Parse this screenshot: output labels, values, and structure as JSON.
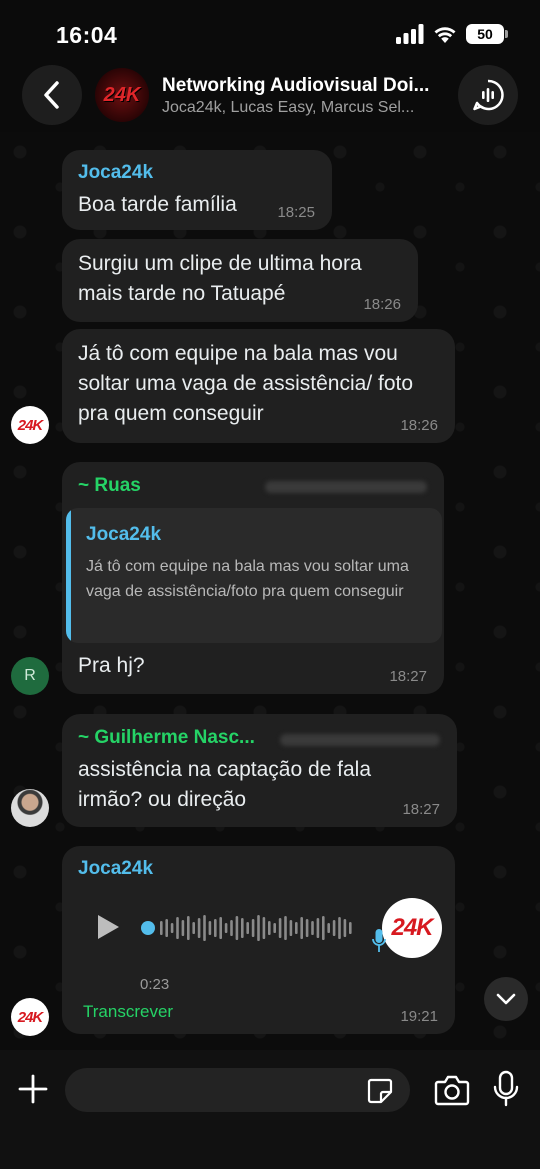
{
  "status_bar": {
    "time": "16:04",
    "battery": "50"
  },
  "header": {
    "title": "Networking Audiovisual Doi...",
    "subtitle": "Joca24k, Lucas Easy, Marcus Sel...",
    "group_avatar_text": "24K"
  },
  "messages": [
    {
      "sender": "Joca24k",
      "text": "Boa tarde família",
      "time": "18:25"
    },
    {
      "text": "Surgiu um clipe de ultima hora mais tarde no Tatuapé",
      "time": "18:26"
    },
    {
      "text": "Já tô com equipe na bala mas vou soltar uma vaga de assistência/ foto pra quem conseguir",
      "time": "18:26",
      "avatar_text": "24K"
    },
    {
      "sender": "~ Ruas",
      "quote": {
        "sender": "Joca24k",
        "text": "Já tô com equipe na bala mas vou soltar uma vaga de assistência/foto pra quem conseguir"
      },
      "text": "Pra hj?",
      "time": "18:27",
      "avatar_text": "R"
    },
    {
      "sender": "~ Guilherme Nasc...",
      "text": "assistência na captação de fala irmão? ou direção",
      "time": "18:27"
    },
    {
      "sender": "Joca24k",
      "voice": {
        "duration": "0:23",
        "transcribe_label": "Transcrever",
        "avatar_text": "24K"
      },
      "time": "19:21",
      "avatar_text": "24K"
    }
  ],
  "composer": {
    "placeholder": ""
  },
  "colors": {
    "sender_blue": "#53bdeb",
    "sender_green": "#25d366",
    "bubble": "#202020"
  }
}
